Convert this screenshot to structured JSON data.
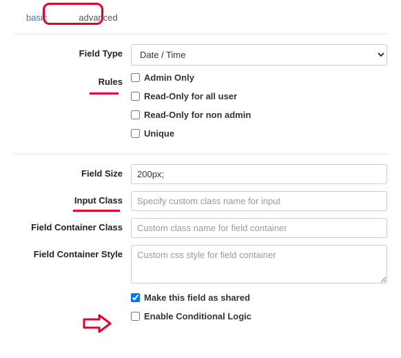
{
  "tabs": {
    "basic": "basic",
    "advanced": "advanced"
  },
  "labels": {
    "field_type": "Field Type",
    "rules": "Rules",
    "field_size": "Field Size",
    "input_class": "Input Class",
    "field_container_class": "Field Container Class",
    "field_container_style": "Field Container Style"
  },
  "field_type_value": "Date / Time",
  "rules": {
    "admin_only": "Admin Only",
    "read_only_all": "Read-Only for all user",
    "read_only_non_admin": "Read-Only for non admin",
    "unique": "Unique"
  },
  "field_size_value": "200px;",
  "placeholders": {
    "input_class": "Specify custom class name for input",
    "container_class": "Custom class name for field container",
    "container_style": "Custom css style for field container"
  },
  "shared": "Make this field as shared",
  "conditional": "Enable Conditional Logic"
}
